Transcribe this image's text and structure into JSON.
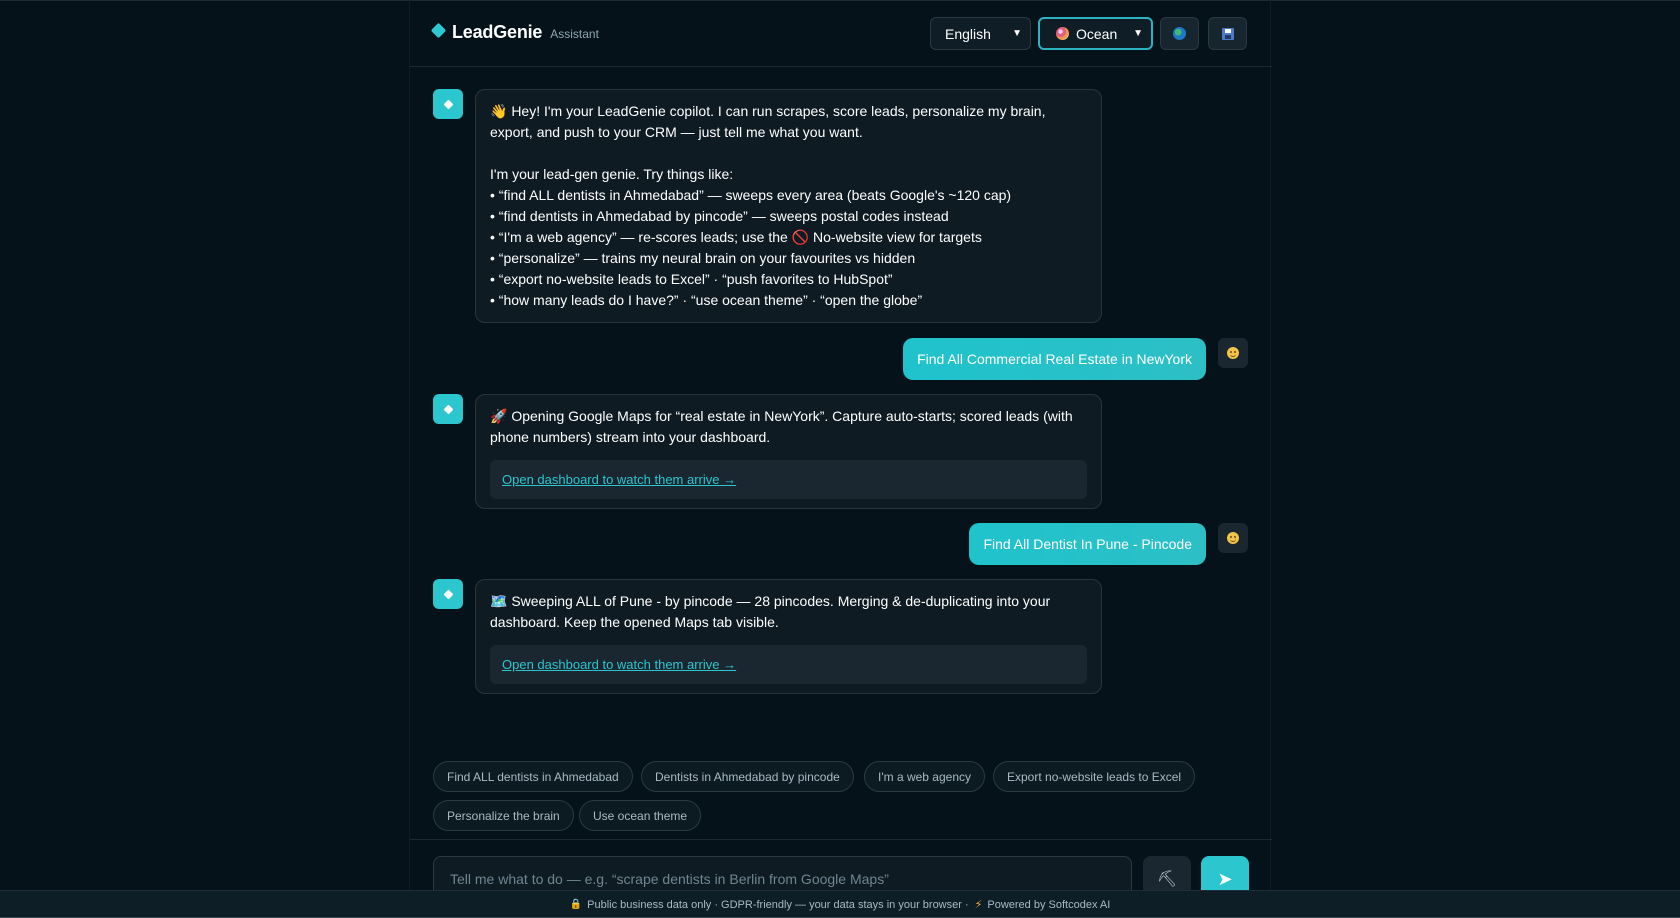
{
  "header": {
    "brand_name": "LeadGenie",
    "brand_sub": "Assistant",
    "language_selected": "English",
    "theme_selected": "Ocean"
  },
  "messages": {
    "bot1": {
      "greeting": "👋 Hey! I'm your LeadGenie copilot. I can run scrapes, score leads, personalize my brain,",
      "greeting2": "export, and push to your CRM — just tell me what you want.",
      "intro": "I'm your lead-gen genie. Try things like:",
      "tips": [
        "• “find ALL dentists in Ahmedabad” — sweeps every area (beats Google's ~120 cap)",
        "• “find dentists in Ahmedabad by pincode” — sweeps postal codes instead",
        "• “I'm a web agency” — re-scores leads; use the 🚫 No-website view for targets",
        "• “personalize” — trains my neural brain on your favourites vs hidden",
        "• “export no-website leads to Excel” · “push favorites to HubSpot”",
        "• “how many leads do I have?” · “use ocean theme” · “open the globe”"
      ]
    },
    "user1": "Find All Commercial Real Estate in NewYork",
    "bot2": {
      "line1": "🚀 Opening Google Maps for “real estate in NewYork”. Capture auto-starts; scored leads (with",
      "line2": "phone numbers) stream into your dashboard.",
      "link": "Open dashboard to watch them arrive →"
    },
    "user2": "Find All Dentist In Pune - Pincode",
    "bot3": {
      "line1": "🗺️ Sweeping ALL of Pune - by pincode — 28 pincodes. Merging & de-duplicating into your",
      "line2": "dashboard. Keep the opened Maps tab visible.",
      "link": "Open dashboard to watch them arrive →"
    }
  },
  "suggestions": [
    "Find ALL dentists in Ahmedabad",
    "Dentists in Ahmedabad by pincode",
    "I'm a web agency",
    "Export no-website leads to Excel",
    "Personalize the brain",
    "Use ocean theme"
  ],
  "composer": {
    "placeholder": "Tell me what to do — e.g. “scrape dentists in Berlin from Google Maps”"
  },
  "footer": {
    "text": "Public business data only · GDPR-friendly — your data stays in your browser ·",
    "powered": "Powered by Softcodex AI"
  },
  "colors": {
    "accent": "#2cc6cf",
    "background": "#051219",
    "bubble": "#0e1b23"
  }
}
